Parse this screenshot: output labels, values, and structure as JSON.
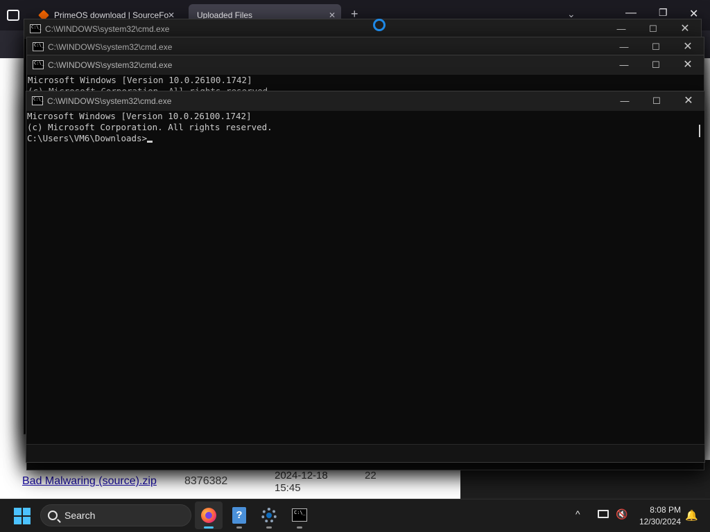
{
  "browser": {
    "tabs": [
      {
        "label": "PrimeOS download | SourceFo"
      },
      {
        "label": "Uploaded Files"
      }
    ],
    "new_tab": "+",
    "list_all_tabs": "⌄",
    "window_controls": {
      "minimize": "—",
      "maximize": "❐",
      "close": "✕"
    },
    "back": "←"
  },
  "page": {
    "file_link": "Bad Malwaring (source).zip",
    "file_size": "8376382",
    "file_date": "2024-12-18",
    "file_time": "15:45",
    "file_count": "22"
  },
  "cmd_windows": [
    {
      "title": "C:\\WINDOWS\\system32\\cmd.exe",
      "lines": []
    },
    {
      "title": "C:\\WINDOWS\\system32\\cmd.exe",
      "lines": []
    },
    {
      "title": "C:\\WINDOWS\\system32\\cmd.exe",
      "lines": [
        "Microsoft Windows [Version 10.0.26100.1742]",
        "(c) Microsoft Corporation. All rights reserved."
      ]
    },
    {
      "title": "C:\\WINDOWS\\system32\\cmd.exe",
      "lines": [
        "Microsoft Windows [Version 10.0.26100.1742]",
        "(c) Microsoft Corporation. All rights reserved.",
        "",
        "C:\\Users\\VM6\\Downloads>"
      ]
    }
  ],
  "cmd_controls": {
    "minimize": "—",
    "maximize": "☐",
    "close": "✕"
  },
  "cmd_icon_text": "C:\\_",
  "taskbar": {
    "search_label": "Search",
    "apps": [
      "firefox",
      "help",
      "settings",
      "terminal"
    ],
    "clock_time": "8:08 PM",
    "clock_date": "12/30/2024",
    "tray_chevron": "^"
  },
  "colors": {
    "accent": "#4cc2ff",
    "console_bg": "#0c0c0c",
    "console_text": "#cccccc",
    "link": "#1a0dab"
  }
}
